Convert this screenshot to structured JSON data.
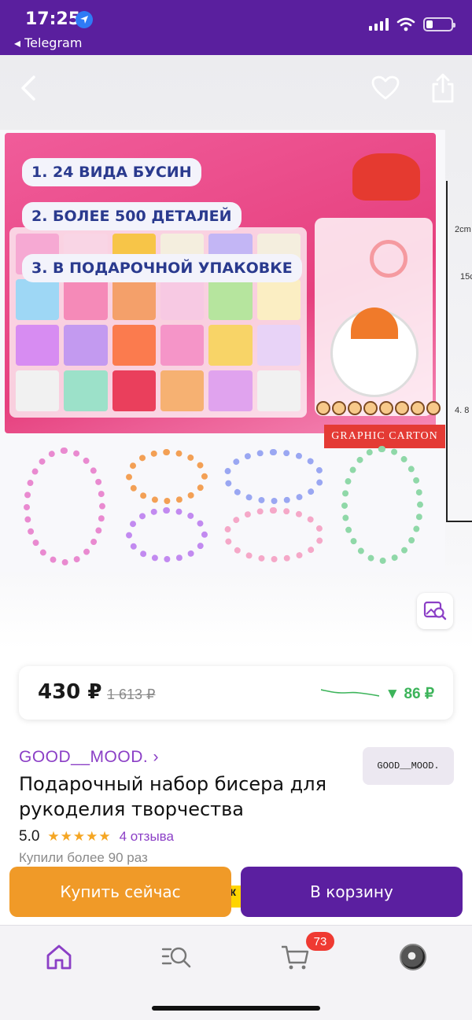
{
  "status_bar": {
    "time": "17:25",
    "back_app": "◂ Telegram",
    "battery_level": 0.2,
    "background": "#5a1f9e"
  },
  "gallery": {
    "icons": [
      "back-arrow-icon",
      "heart-icon",
      "share-icon",
      "visual-search-icon"
    ],
    "image_tags": [
      "1. 24 ВИДА БУСИН",
      "2. БОЛЕЕ 500 ДЕТАЛЕЙ",
      "3. В ПОДАРОЧНОЙ УПАКОВКЕ"
    ],
    "carton_label": "GRAPHIC CARTON",
    "dimension_labels": [
      "2cm",
      "15c",
      "4. 8"
    ]
  },
  "price": {
    "current": "430 ₽",
    "old": "1 613 ₽",
    "drop": "▼ 86 ₽",
    "drop_color": "#3cb45a"
  },
  "seller": {
    "name": "GOOD__MOOD. ›",
    "logo_text": "GOOD__MOOD."
  },
  "product": {
    "title": "Подарочный набор бисера для рукоделия творчества",
    "rating": "5.0",
    "stars": "★★★★★",
    "reviews": "4 отзыва",
    "bought": "Купили более 90 раз"
  },
  "actions": {
    "buy_now": "Купить сейчас",
    "add_to_cart": "В корзину",
    "peek_text": "к",
    "buy_color": "#f09a28",
    "cart_color": "#5b1fa0"
  },
  "tab_bar": {
    "tabs": [
      "home-icon",
      "catalog-search-icon",
      "cart-icon",
      "profile-avatar"
    ],
    "cart_badge": "73",
    "accent": "#8b3fc6"
  }
}
